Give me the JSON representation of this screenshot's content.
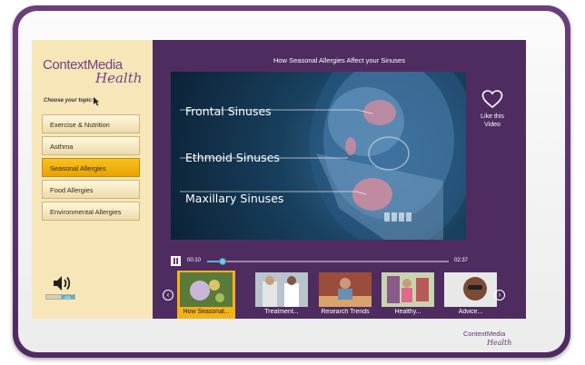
{
  "logo": {
    "line1": "ContextMedia",
    "line2": "Health"
  },
  "sidebar": {
    "prompt": "Choose your topic:",
    "topics": [
      {
        "label": "Exercise & Nutrition",
        "active": false
      },
      {
        "label": "Asthma",
        "active": false
      },
      {
        "label": "Seasonal Allergies",
        "active": true
      },
      {
        "label": "Food Allergies",
        "active": false
      },
      {
        "label": "Environmental Allergies",
        "active": false
      }
    ],
    "volume_label": "ON"
  },
  "video": {
    "title": "How Seasonal Allergies Affect your Sinuses",
    "labels": [
      "Frontal Sinuses",
      "Ethmoid Sinuses",
      "Maxillary Sinuses"
    ],
    "like_label": "Like this Video",
    "current_time": "00:10",
    "total_time": "02:37",
    "progress": 0.064
  },
  "playlist": [
    {
      "label": "How Seasonal...",
      "active": true
    },
    {
      "label": "Treatment...",
      "active": false
    },
    {
      "label": "Research Trends",
      "active": false
    },
    {
      "label": "Healthy...",
      "active": false
    },
    {
      "label": "Advice...",
      "active": false
    }
  ],
  "colors": {
    "frame": "#5a3470",
    "sidebar": "#f7e6b7",
    "accent": "#f2b21a",
    "screen": "#4f2c60"
  },
  "icons": [
    "pointer-cursor-icon",
    "speaker-icon",
    "heart-icon",
    "pause-icon",
    "chevron-left-icon",
    "chevron-right-icon"
  ]
}
